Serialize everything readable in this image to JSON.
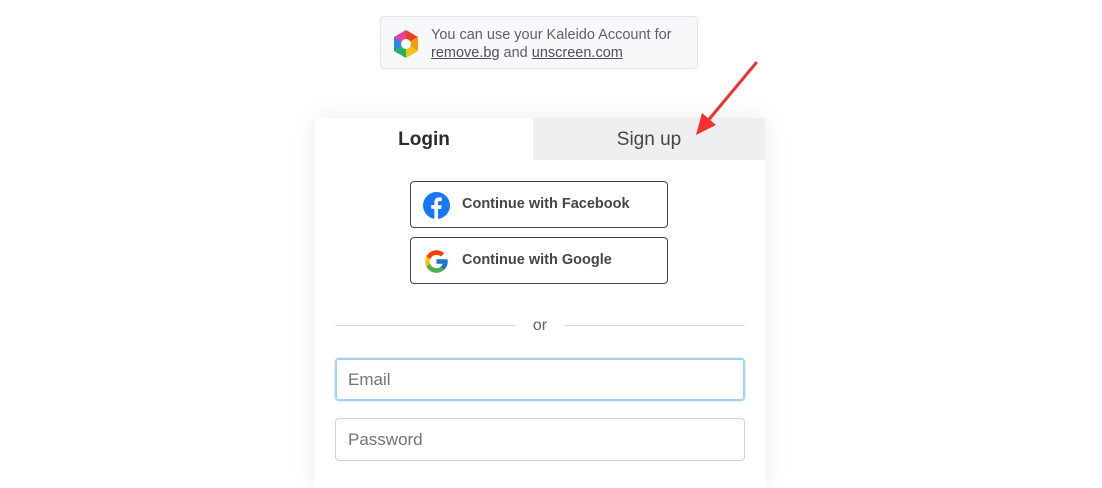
{
  "notice": {
    "text_prefix": "You can use your Kaleido Account for",
    "link_removebg": "remove.bg",
    "and_text": "and",
    "link_unscreen": "unscreen.com"
  },
  "tabs": {
    "login": "Login",
    "signup": "Sign up"
  },
  "social": {
    "facebook": "Continue with Facebook",
    "google": "Continue with Google"
  },
  "divider": {
    "or": "or"
  },
  "form": {
    "email_placeholder": "Email",
    "email_value": "",
    "password_placeholder": "Password",
    "password_value": ""
  },
  "colors": {
    "annotation_arrow": "#f03232",
    "facebook_blue": "#1877f2",
    "focus_border": "#a7d2f5",
    "tab_inactive_bg": "#eeeff1"
  },
  "icons": {
    "notice_logo": "kaleido-logo-icon",
    "facebook": "facebook-icon",
    "google": "google-icon"
  }
}
